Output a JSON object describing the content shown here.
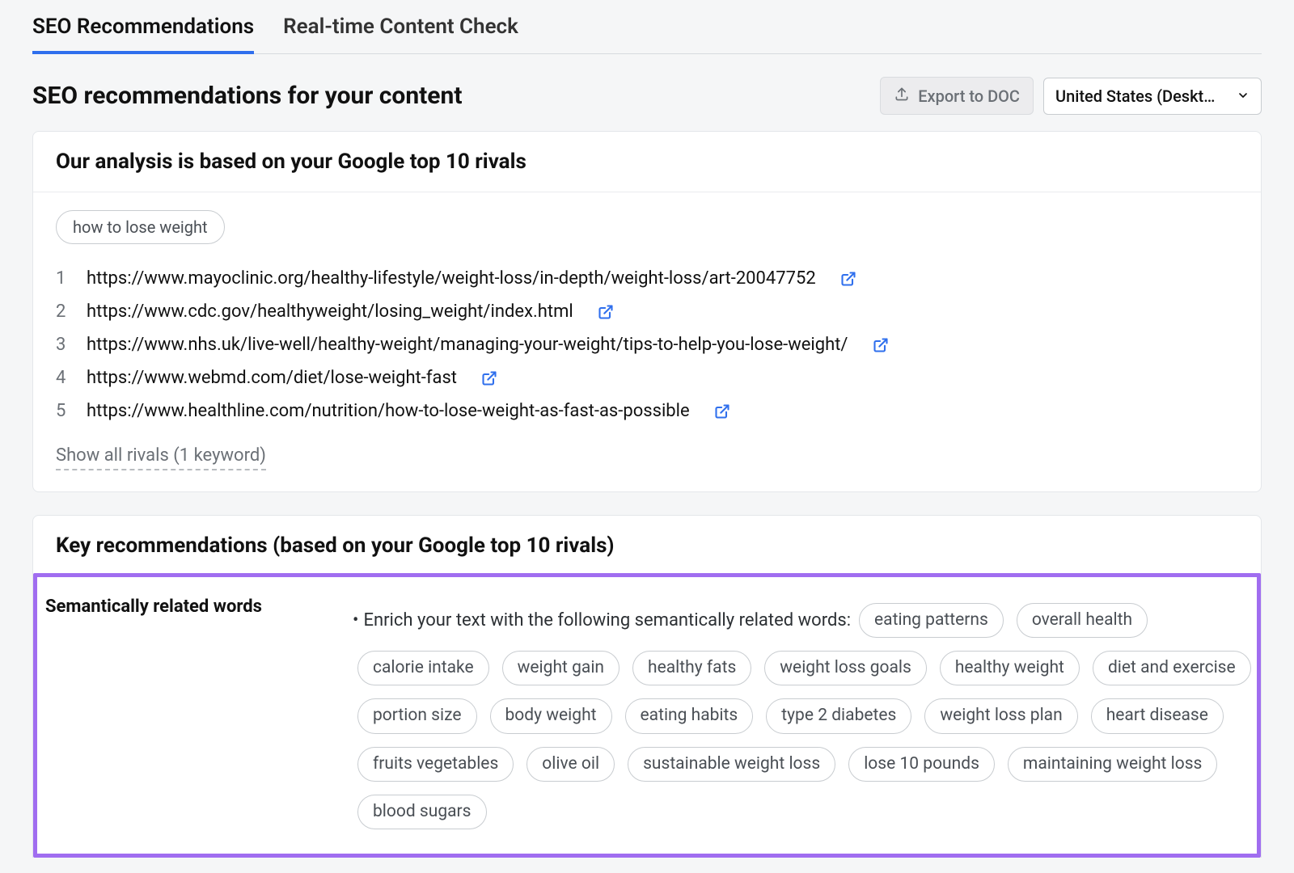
{
  "tabs": {
    "seo": "SEO Recommendations",
    "realtime": "Real-time Content Check"
  },
  "header": {
    "title": "SEO recommendations for your content",
    "export_label": "Export to DOC",
    "database_label": "United States (Deskt…"
  },
  "rivals_card": {
    "title": "Our analysis is based on your Google top 10 rivals",
    "keyword_pill": "how to lose weight",
    "rivals": [
      "https://www.mayoclinic.org/healthy-lifestyle/weight-loss/in-depth/weight-loss/art-20047752",
      "https://www.cdc.gov/healthyweight/losing_weight/index.html",
      "https://www.nhs.uk/live-well/healthy-weight/managing-your-weight/tips-to-help-you-lose-weight/",
      "https://www.webmd.com/diet/lose-weight-fast",
      "https://www.healthline.com/nutrition/how-to-lose-weight-as-fast-as-possible"
    ],
    "rival_numbers": [
      "1",
      "2",
      "3",
      "4",
      "5"
    ],
    "show_all": "Show all rivals (1 keyword)"
  },
  "key_recs_card": {
    "title": "Key recommendations (based on your Google top 10 rivals)",
    "section_label": "Semantically related words",
    "intro_text": "Enrich your text with the following semantically related words:",
    "words": [
      "eating patterns",
      "overall health",
      "calorie intake",
      "weight gain",
      "healthy fats",
      "weight loss goals",
      "healthy weight",
      "diet and exercise",
      "portion size",
      "body weight",
      "eating habits",
      "type 2 diabetes",
      "weight loss plan",
      "heart disease",
      "fruits vegetables",
      "olive oil",
      "sustainable weight loss",
      "lose 10 pounds",
      "maintaining weight loss",
      "blood sugars"
    ]
  }
}
